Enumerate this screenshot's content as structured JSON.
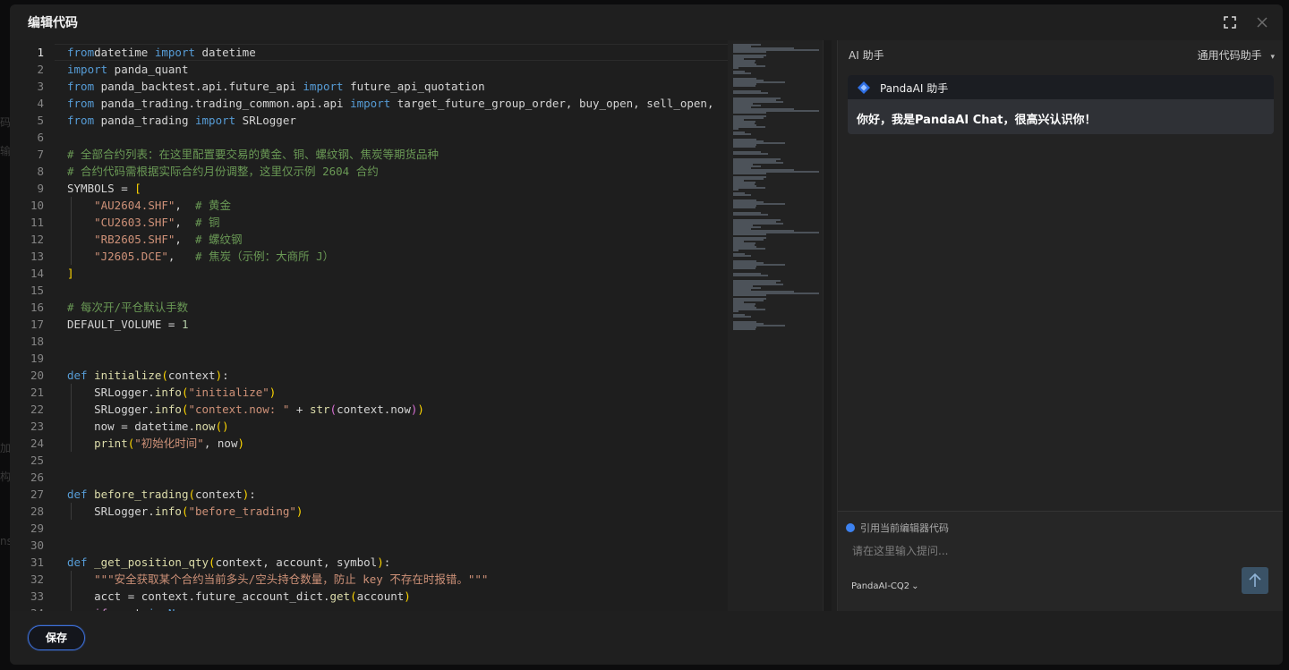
{
  "modal": {
    "title": "编辑代码"
  },
  "backdrop_hints": [
    "码",
    "输",
    "加",
    "构",
    "ns"
  ],
  "editor": {
    "active_line": 1,
    "lines": [
      [
        [
          "kw",
          "from"
        ],
        [
          "",
          "datetime "
        ],
        [
          "kw",
          "import"
        ],
        [
          "",
          " datetime"
        ]
      ],
      [
        [
          "kw",
          "import"
        ],
        [
          "",
          " panda_quant"
        ]
      ],
      [
        [
          "kw",
          "from"
        ],
        [
          "",
          " panda_backtest.api.future_api "
        ],
        [
          "kw",
          "import"
        ],
        [
          "",
          " future_api_quotation"
        ]
      ],
      [
        [
          "kw",
          "from"
        ],
        [
          "",
          " panda_trading.trading_common.api.api "
        ],
        [
          "kw",
          "import"
        ],
        [
          "",
          " target_future_group_order, buy_open, sell_open,"
        ]
      ],
      [
        [
          "kw",
          "from"
        ],
        [
          "",
          " panda_trading "
        ],
        [
          "kw",
          "import"
        ],
        [
          "",
          " SRLogger"
        ]
      ],
      [],
      [
        [
          "cm",
          "# 全部合约列表：在这里配置要交易的黄金、铜、螺纹钢、焦炭等期货品种"
        ]
      ],
      [
        [
          "cm",
          "# 合约代码需根据实际合约月份调整，这里仅示例 2604 合约"
        ]
      ],
      [
        [
          "",
          "SYMBOLS = "
        ],
        [
          "br1",
          "["
        ]
      ],
      [
        [
          "",
          "    "
        ],
        [
          "str",
          "\"AU2604.SHF\""
        ],
        [
          "",
          ",  "
        ],
        [
          "cm",
          "# 黄金"
        ]
      ],
      [
        [
          "",
          "    "
        ],
        [
          "str",
          "\"CU2603.SHF\""
        ],
        [
          "",
          ",  "
        ],
        [
          "cm",
          "# 铜"
        ]
      ],
      [
        [
          "",
          "    "
        ],
        [
          "str",
          "\"RB2605.SHF\""
        ],
        [
          "",
          ",  "
        ],
        [
          "cm",
          "# 螺纹钢"
        ]
      ],
      [
        [
          "",
          "    "
        ],
        [
          "str",
          "\"J2605.DCE\""
        ],
        [
          "",
          ",   "
        ],
        [
          "cm",
          "# 焦炭（示例：大商所 J）"
        ]
      ],
      [
        [
          "br1",
          "]"
        ]
      ],
      [],
      [
        [
          "cm",
          "# 每次开/平仓默认手数"
        ]
      ],
      [
        [
          "",
          "DEFAULT_VOLUME = "
        ],
        [
          "num",
          "1"
        ]
      ],
      [],
      [],
      [
        [
          "kw",
          "def"
        ],
        [
          "",
          " "
        ],
        [
          "fn",
          "initialize"
        ],
        [
          "br1",
          "("
        ],
        [
          "",
          "context"
        ],
        [
          "br1",
          ")"
        ],
        [
          "",
          ":"
        ]
      ],
      [
        [
          "",
          "    SRLogger."
        ],
        [
          "fn",
          "info"
        ],
        [
          "br1",
          "("
        ],
        [
          "str",
          "\"initialize\""
        ],
        [
          "br1",
          ")"
        ]
      ],
      [
        [
          "",
          "    SRLogger."
        ],
        [
          "fn",
          "info"
        ],
        [
          "br1",
          "("
        ],
        [
          "str",
          "\"context.now: \""
        ],
        [
          "",
          " + "
        ],
        [
          "fn",
          "str"
        ],
        [
          "br2",
          "("
        ],
        [
          "",
          "context.now"
        ],
        [
          "br2",
          ")"
        ],
        [
          "br1",
          ")"
        ]
      ],
      [
        [
          "",
          "    now = datetime."
        ],
        [
          "fn",
          "now"
        ],
        [
          "br1",
          "()"
        ]
      ],
      [
        [
          "",
          "    "
        ],
        [
          "fn",
          "print"
        ],
        [
          "br1",
          "("
        ],
        [
          "str",
          "\"初始化时间\""
        ],
        [
          "",
          ", now"
        ],
        [
          "br1",
          ")"
        ]
      ],
      [],
      [],
      [
        [
          "kw",
          "def"
        ],
        [
          "",
          " "
        ],
        [
          "fn",
          "before_trading"
        ],
        [
          "br1",
          "("
        ],
        [
          "",
          "context"
        ],
        [
          "br1",
          ")"
        ],
        [
          "",
          ":"
        ]
      ],
      [
        [
          "",
          "    SRLogger."
        ],
        [
          "fn",
          "info"
        ],
        [
          "br1",
          "("
        ],
        [
          "str",
          "\"before_trading\""
        ],
        [
          "br1",
          ")"
        ]
      ],
      [],
      [],
      [
        [
          "kw",
          "def"
        ],
        [
          "",
          " "
        ],
        [
          "fn",
          "_get_position_qty"
        ],
        [
          "br1",
          "("
        ],
        [
          "",
          "context, account, symbol"
        ],
        [
          "br1",
          ")"
        ],
        [
          "",
          ":"
        ]
      ],
      [
        [
          "",
          "    "
        ],
        [
          "str",
          "\"\"\"安全获取某个合约当前多头/空头持仓数量，防止 key 不存在时报错。\"\"\""
        ]
      ],
      [
        [
          "",
          "    acct = context.future_account_dict."
        ],
        [
          "fn",
          "get"
        ],
        [
          "br1",
          "("
        ],
        [
          "",
          "account"
        ],
        [
          "br1",
          ")"
        ]
      ],
      [
        [
          "",
          "    "
        ],
        [
          "ctrl",
          "if"
        ],
        [
          "",
          " acct "
        ],
        [
          "kw",
          "is"
        ],
        [
          "",
          " "
        ],
        [
          "kw",
          "None"
        ],
        [
          "",
          ":"
        ]
      ]
    ]
  },
  "ai": {
    "title": "AI 助手",
    "mode_label": "通用代码助手",
    "card_name": "PandaAI 助手",
    "greeting": "你好，我是PandaAI Chat，很高兴认识你！",
    "reference_label": "引用当前编辑器代码",
    "input_placeholder": "请在这里输入提问...",
    "model_label": "PandaAI-CQ2",
    "accent": "#3d82f0"
  },
  "footer": {
    "save_label": "保存"
  },
  "icons": {
    "fullscreen": "fullscreen-icon",
    "close": "close-icon",
    "send": "arrow-up-icon",
    "logo": "panda-logo-icon"
  }
}
